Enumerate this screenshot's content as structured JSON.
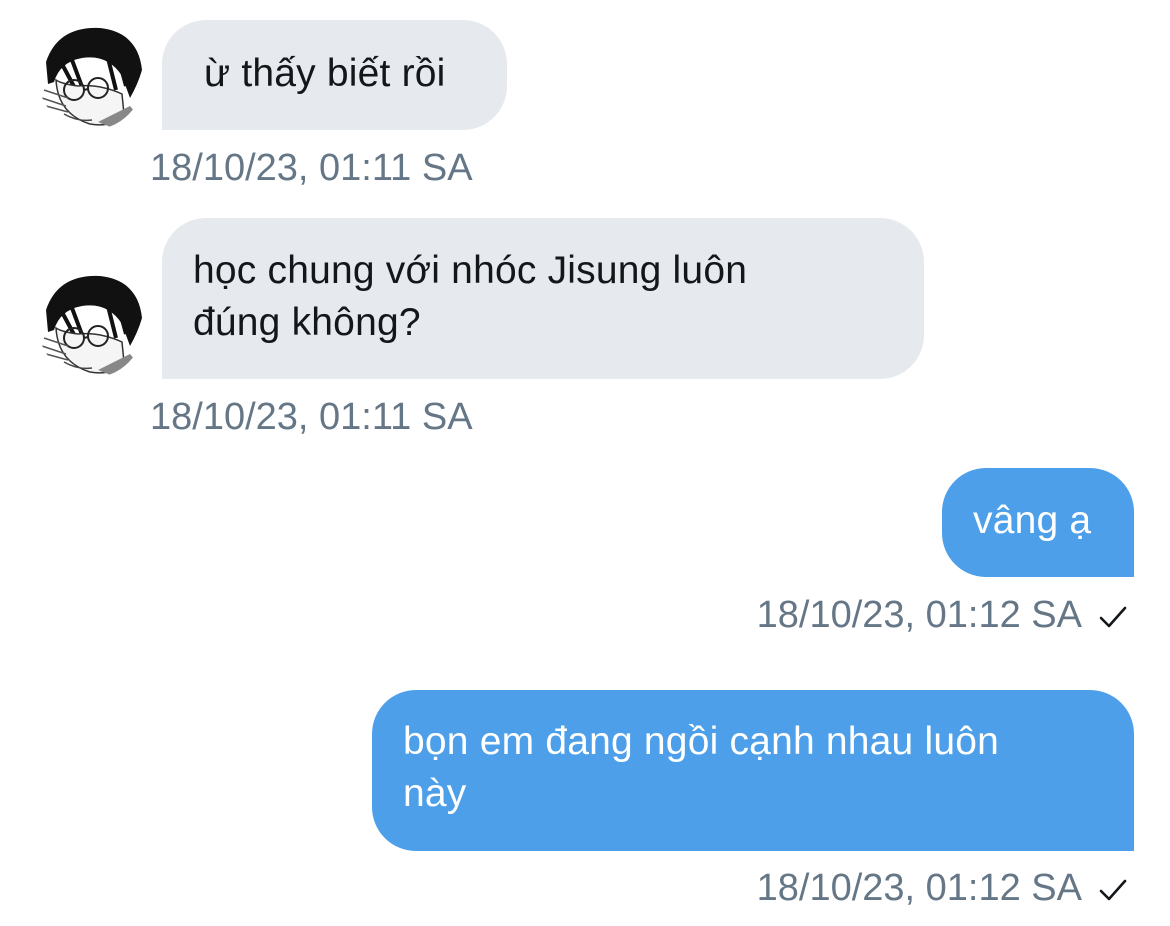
{
  "conversation": {
    "messages": [
      {
        "direction": "incoming",
        "avatar_icon": "contact-avatar-icon",
        "lines": [
          "ừ thấy biết rồi"
        ],
        "timestamp": "18/10/23, 01:11 SA"
      },
      {
        "direction": "incoming",
        "avatar_icon": "contact-avatar-icon",
        "lines": [
          "học chung với nhóc Jisung luôn",
          "đúng không?"
        ],
        "timestamp": "18/10/23, 01:11 SA"
      },
      {
        "direction": "outgoing",
        "lines": [
          "vâng ạ"
        ],
        "timestamp": "18/10/23, 01:12 SA",
        "status_icon": "checkmark-icon"
      },
      {
        "direction": "outgoing",
        "lines": [
          "bọn em đang ngồi cạnh nhau luôn",
          "này"
        ],
        "timestamp": "18/10/23, 01:12 SA",
        "status_icon": "checkmark-icon"
      }
    ]
  },
  "colors": {
    "incoming_bubble": "#e6e9ed",
    "incoming_text": "#14171a",
    "outgoing_bubble": "#4d9fe9",
    "outgoing_text": "#ffffff",
    "timestamp_text": "#657786",
    "checkmark": "#14171a"
  }
}
